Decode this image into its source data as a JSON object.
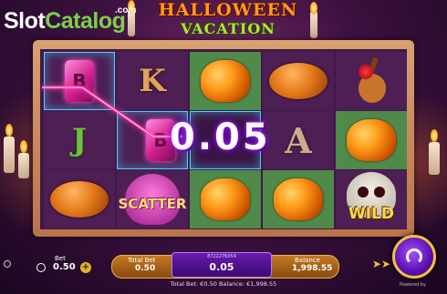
{
  "logo": {
    "slot": "Slot",
    "catalog": "Catalog",
    "com": ".com"
  },
  "title": {
    "line1": "HALLOWEEN",
    "line2": "VACATION"
  },
  "reels": {
    "rows": [
      [
        "gem",
        "K",
        "marigold",
        "pan-de-muerto",
        "guitar-rose"
      ],
      [
        "J",
        "gem",
        "0.05",
        "A",
        "marigold"
      ],
      [
        "pan-de-muerto",
        "SCATTER",
        "marigold",
        "marigold",
        "WILD"
      ]
    ],
    "letters": {
      "k": "K",
      "j": "J",
      "a": "A"
    },
    "scatter_label": "SCATTER",
    "wild_label": "WILD",
    "gem_glyph": "B"
  },
  "win": {
    "amount": "0.05"
  },
  "bet": {
    "label": "Bet",
    "value": "0.50",
    "minus": "−",
    "plus": "+"
  },
  "panel": {
    "total_bet_label": "Total Bet",
    "total_bet_value": "0.50",
    "round_id": "8722276054",
    "win_value": "0.05",
    "balance_label": "Balance",
    "balance_value": "1,998.55"
  },
  "footer": {
    "text": "Total Bet: €0.50  Balance: €1,998.55",
    "powered": "Powered by"
  },
  "colors": {
    "accent": "#6a1ab0",
    "win_line": "#ff3aa8",
    "highlight": "#4ad2ff",
    "panel": "#c27a20"
  }
}
